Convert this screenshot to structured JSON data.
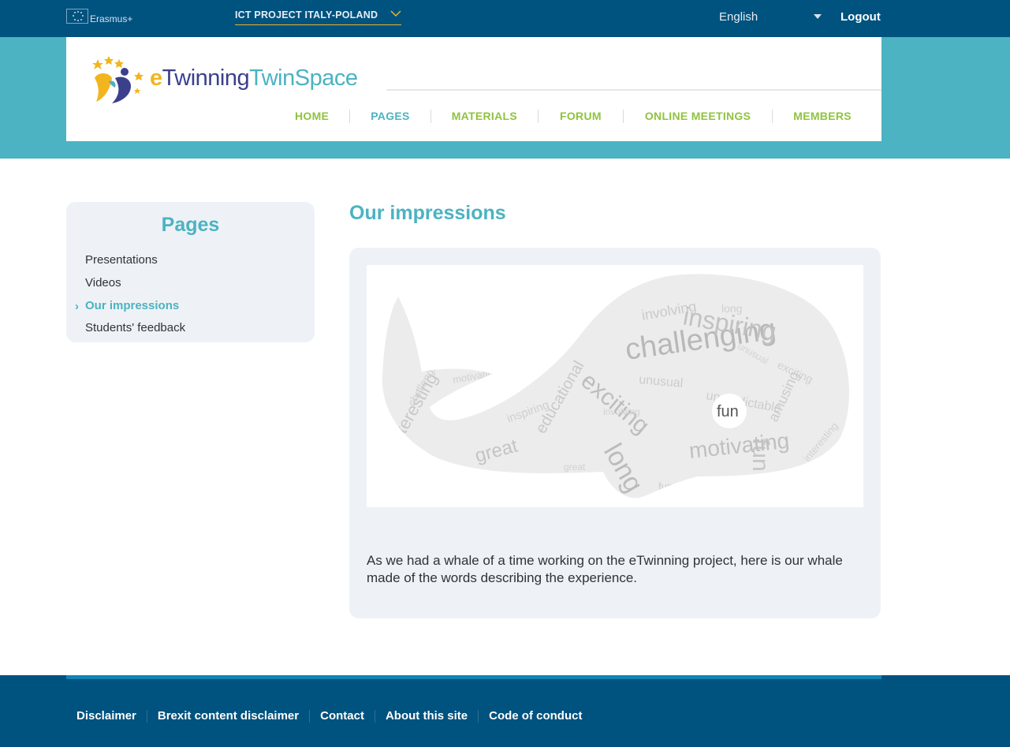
{
  "topbar": {
    "programme_label": "Erasmus+",
    "project_name": "ICT PROJECT ITALY-POLAND",
    "language": "English",
    "logout_label": "Logout"
  },
  "header": {
    "logo": {
      "part1": "e",
      "part2": "Twinning",
      "part3": "TwinSpace"
    },
    "nav": [
      "HOME",
      "PAGES",
      "MATERIALS",
      "FORUM",
      "ONLINE MEETINGS",
      "MEMBERS"
    ],
    "active_nav": "PAGES"
  },
  "sidebar": {
    "title": "Pages",
    "items": [
      "Presentations",
      "Videos",
      "Our impressions",
      "Students' feedback"
    ],
    "active_item": "Our impressions"
  },
  "main": {
    "title": "Our impressions",
    "image": {
      "icon": "whale-word-cloud-image",
      "words": [
        "challenging",
        "inspiring",
        "exciting",
        "fun",
        "motivating",
        "long",
        "interesting",
        "great",
        "educational",
        "involving",
        "unusual",
        "amusing",
        "unpredictable"
      ]
    },
    "caption": "As we had a whale of a time working on the eTwinning project, here is our whale made of the words describing the experience."
  },
  "footer": {
    "links": [
      "Disclaimer",
      "Brexit content disclaimer",
      "Contact",
      "About this site",
      "Code of conduct"
    ]
  },
  "colors": {
    "top_bar": "#00527f",
    "header_band": "#4bb3c1",
    "nav_green": "#8fc33e",
    "accent_teal": "#4bb3c1",
    "panel_bg": "#eef2f6"
  }
}
